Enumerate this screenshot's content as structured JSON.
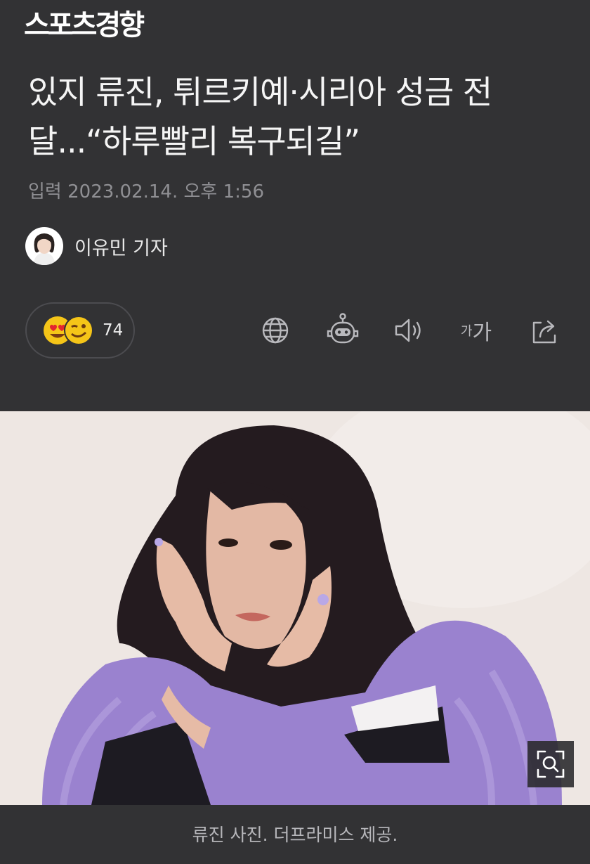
{
  "masthead": {
    "brand": "스포츠경향"
  },
  "article": {
    "headline": "있지 류진, 튀르키예·시리아 성금 전달...“하루빨리 복구되길”",
    "dateline": "입력 2023.02.14. 오후 1:56",
    "author": "이유민 기자"
  },
  "reactions": {
    "count": "74",
    "icons": [
      "heart-eyes-emoji-icon",
      "winking-emoji-icon"
    ]
  },
  "toolbar": {
    "items": [
      "translate-globe-icon",
      "ai-bot-icon",
      "speaker-icon",
      "font-size-icon",
      "share-icon"
    ],
    "font_size_small": "가",
    "font_size_large": "가"
  },
  "photo": {
    "caption": "류진 사진. 더프라미스 제공.",
    "zoom_icon": "magnify-icon"
  },
  "colors": {
    "background": "#323234",
    "muted_text": "#8f8f93",
    "emoji_yellow": "#f5c518",
    "fur_purple": "#9a82cf"
  }
}
